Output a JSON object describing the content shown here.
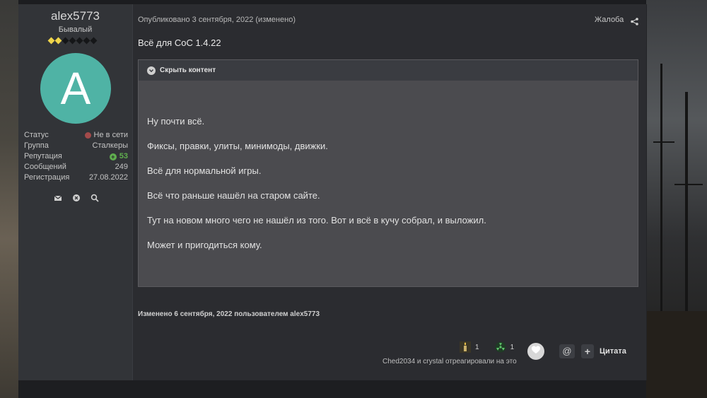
{
  "author": {
    "name": "alex5773",
    "rank": "Бывалый",
    "rank_pips": 7,
    "rank_pips_filled": 2,
    "avatar_letter": "A",
    "avatar_color": "#4fb3a5",
    "stats": [
      {
        "label": "Статус",
        "value": "Не в сети"
      },
      {
        "label": "Группа",
        "value": "Сталкеры"
      },
      {
        "label": "Репутация",
        "value": "53"
      },
      {
        "label": "Сообщений",
        "value": "249"
      },
      {
        "label": "Регистрация",
        "value": "27.08.2022"
      }
    ],
    "icons": [
      "mail-icon",
      "block-icon",
      "search-icon"
    ]
  },
  "post": {
    "meta": "Опубликовано 3 сентября, 2022 (изменено)",
    "report_label": "Жалоба",
    "title": "Всё для CoC 1.4.22",
    "spoiler_label": "Скрыть контент",
    "paragraphs": [
      "Ну почти всё.",
      "Фиксы, правки, улиты, минимоды, движки.",
      "Всё для нормальной игры.",
      "Всё что раньше нашёл на старом сайте.",
      "Тут на новом много чего не нашёл из того. Вот и всё в кучу собрал, и выложил.",
      "Может и пригодиться кому."
    ],
    "edited_note": "Изменено 6 сентября, 2022 пользователем alex5773"
  },
  "reactions": {
    "items": [
      {
        "icon": "candle-icon",
        "count": "1"
      },
      {
        "icon": "radiation-icon",
        "count": "1"
      }
    ],
    "summary": "Ched2034 и crystal отреагировали на это",
    "mention_label": "@",
    "quote_plus": "+",
    "quote_label": "Цитата"
  },
  "colors": {
    "accent_rep": "#5fae4e",
    "offline": "#a34a4a",
    "rank_pip": "#f0d54a"
  }
}
